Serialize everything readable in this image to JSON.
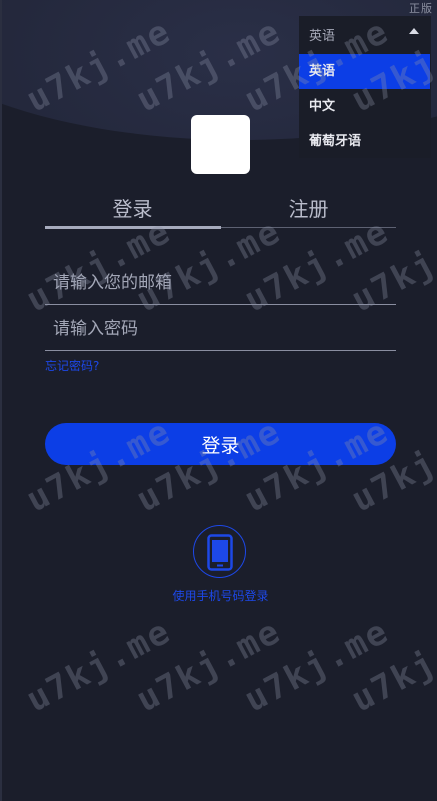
{
  "header": {
    "version_tag": "正版"
  },
  "language": {
    "current": "英语",
    "options": [
      {
        "label": "英语",
        "active": true
      },
      {
        "label": "中文",
        "active": false
      },
      {
        "label": "葡萄牙语",
        "active": false
      }
    ]
  },
  "tabs": {
    "login": "登录",
    "register": "注册",
    "active": "login"
  },
  "form": {
    "email_placeholder": "请输入您的邮箱",
    "password_placeholder": "请输入密码",
    "forgot_password": "忘记密码?",
    "submit_label": "登录"
  },
  "alt_login": {
    "icon": "mobile-phone-icon",
    "label": "使用手机号码登录"
  },
  "watermark": {
    "text": "u7kj.me"
  },
  "colors": {
    "background": "#1b1e2b",
    "accent": "#0c3ee6",
    "link": "#1d48e8"
  }
}
